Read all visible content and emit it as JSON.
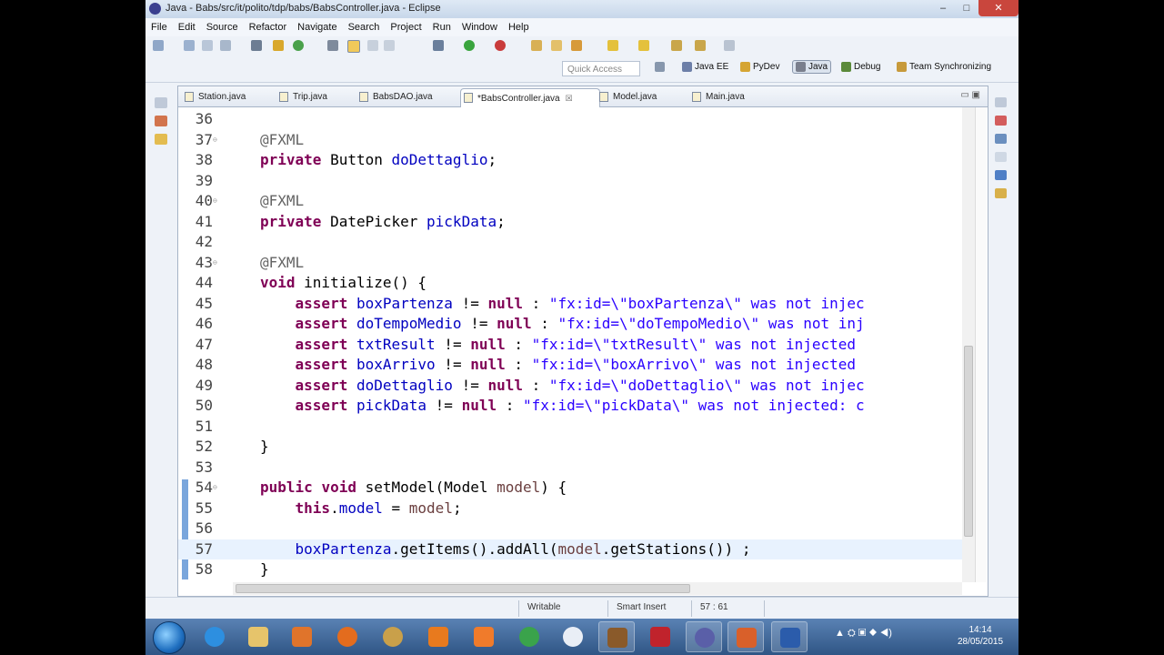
{
  "window": {
    "title": "Java - Babs/src/it/polito/tdp/babs/BabsController.java - Eclipse"
  },
  "window_buttons": {
    "minimize": "–",
    "maximize": "□",
    "close": "✕"
  },
  "menu": [
    "File",
    "Edit",
    "Source",
    "Refactor",
    "Navigate",
    "Search",
    "Project",
    "Run",
    "Window",
    "Help"
  ],
  "quick_access": {
    "placeholder": "Quick Access"
  },
  "perspectives": [
    "Java EE",
    "PyDev",
    "Java",
    "Debug",
    "Team Synchronizing"
  ],
  "active_perspective": "Java",
  "tabs": [
    {
      "label": "Station.java"
    },
    {
      "label": "Trip.java"
    },
    {
      "label": "BabsDAO.java"
    },
    {
      "label": "*BabsController.java",
      "close": "☒"
    },
    {
      "label": "Model.java"
    },
    {
      "label": "Main.java"
    }
  ],
  "panel_buttons": "▭ ▣",
  "code": {
    "lines": [
      {
        "n": "36",
        "fold": "",
        "html": ""
      },
      {
        "n": "37",
        "fold": "⊖",
        "html": "<span class='ann'>@FXML</span>"
      },
      {
        "n": "38",
        "fold": "",
        "html": "<span class='kw'>private</span> Button <span class='fld'>doDettaglio</span>;"
      },
      {
        "n": "39",
        "fold": "",
        "html": ""
      },
      {
        "n": "40",
        "fold": "⊖",
        "html": "<span class='ann'>@FXML</span>"
      },
      {
        "n": "41",
        "fold": "",
        "html": "<span class='kw'>private</span> DatePicker <span class='fld'>pickData</span>;"
      },
      {
        "n": "42",
        "fold": "",
        "html": ""
      },
      {
        "n": "43",
        "fold": "⊖",
        "html": "<span class='ann'>@FXML</span>"
      },
      {
        "n": "44",
        "fold": "",
        "html": "<span class='kw'>void</span> initialize() {"
      },
      {
        "n": "45",
        "fold": "",
        "html": "    <span class='kw'>assert</span> <span class='fld'>boxPartenza</span> != <span class='kw'>null</span> : <span class='str'>\"fx:id=\\\"boxPartenza\\\" was not injec</span>"
      },
      {
        "n": "46",
        "fold": "",
        "html": "    <span class='kw'>assert</span> <span class='fld'>doTempoMedio</span> != <span class='kw'>null</span> : <span class='str'>\"fx:id=\\\"doTempoMedio\\\" was not inj</span>"
      },
      {
        "n": "47",
        "fold": "",
        "html": "    <span class='kw'>assert</span> <span class='fld'>txtResult</span> != <span class='kw'>null</span> : <span class='str'>\"fx:id=\\\"txtResult\\\" was not injected</span>"
      },
      {
        "n": "48",
        "fold": "",
        "html": "    <span class='kw'>assert</span> <span class='fld'>boxArrivo</span> != <span class='kw'>null</span> : <span class='str'>\"fx:id=\\\"boxArrivo\\\" was not injected</span>"
      },
      {
        "n": "49",
        "fold": "",
        "html": "    <span class='kw'>assert</span> <span class='fld'>doDettaglio</span> != <span class='kw'>null</span> : <span class='str'>\"fx:id=\\\"doDettaglio\\\" was not injec</span>"
      },
      {
        "n": "50",
        "fold": "",
        "html": "    <span class='kw'>assert</span> <span class='fld'>pickData</span> != <span class='kw'>null</span> : <span class='str'>\"fx:id=\\\"pickData\\\" was not injected: c</span>"
      },
      {
        "n": "51",
        "fold": "",
        "html": ""
      },
      {
        "n": "52",
        "fold": "",
        "html": "}"
      },
      {
        "n": "53",
        "fold": "",
        "html": ""
      },
      {
        "n": "54",
        "fold": "⊖",
        "html": "<span class='kw'>public</span> <span class='kw'>void</span> setModel(Model <span class='var'>model</span>) {"
      },
      {
        "n": "55",
        "fold": "",
        "html": "    <span class='kw'>this</span>.<span class='fld'>model</span> = <span class='var'>model</span>;"
      },
      {
        "n": "56",
        "fold": "",
        "html": ""
      },
      {
        "n": "57",
        "fold": "",
        "html": "    <span class='fld'>boxPartenza</span>.getItems().addAll(<span class='var'>model</span>.getStations()) ;",
        "current": true
      },
      {
        "n": "58",
        "fold": "",
        "html": "}"
      }
    ]
  },
  "status": {
    "writable": "Writable",
    "insert_mode": "Smart Insert",
    "position": "57 : 61"
  },
  "taskbar": {
    "apps": [
      "ie-icon",
      "explorer-icon",
      "media-player-icon",
      "firefox-icon",
      "burger-icon",
      "magnet-icon",
      "xampp-icon",
      "hs-icon",
      "bird-icon",
      "cat-icon",
      "x-app-icon",
      "presentation-icon",
      "word-icon",
      "eclipse-icon"
    ],
    "time": "14:14",
    "date": "28/05/2015"
  },
  "colors": {
    "keyword": "#7f0055",
    "string": "#2a00ff",
    "field": "#0000c0",
    "annotation": "#646464",
    "close_button": "#c9463d"
  }
}
